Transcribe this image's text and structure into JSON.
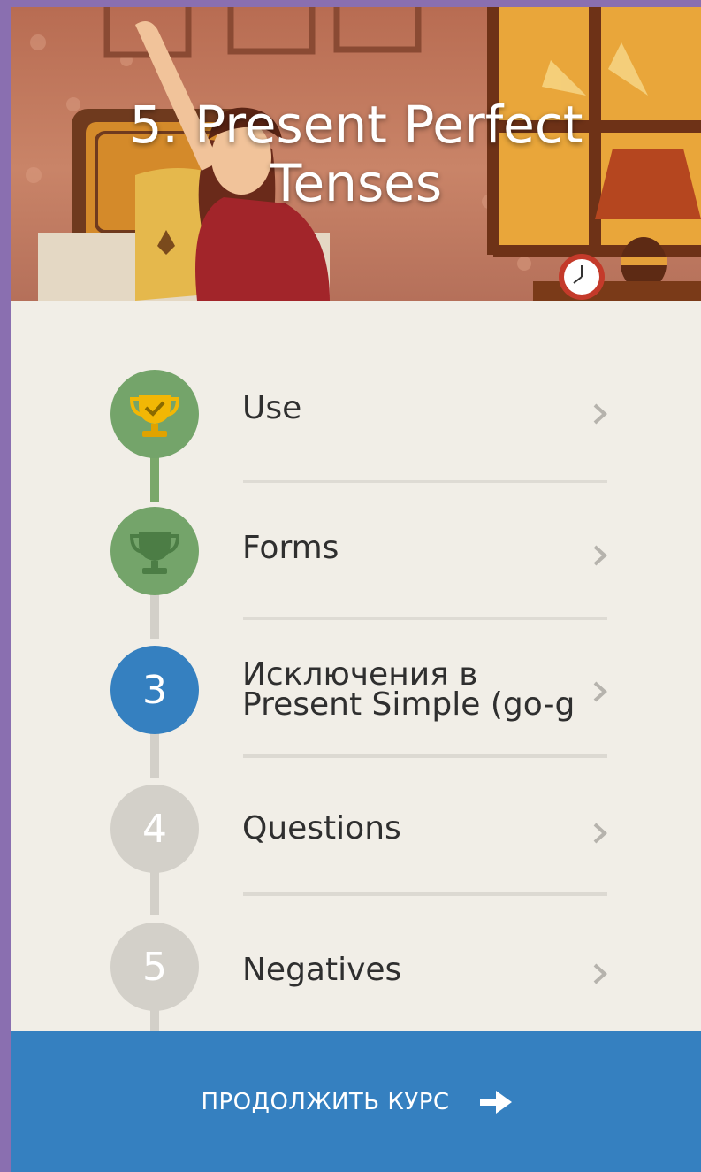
{
  "header": {
    "title_line1": "5. Present Perfect",
    "title_line2": "Tenses"
  },
  "lessons": [
    {
      "step": "1",
      "label": "Use",
      "status": "completed",
      "icon": "trophy-gold-check-icon"
    },
    {
      "step": "2",
      "label": "Forms",
      "status": "completed",
      "icon": "trophy-green-icon"
    },
    {
      "step": "3",
      "label_line1": "Исключения в",
      "label_line2": "Present Simple (go-g",
      "status": "current"
    },
    {
      "step": "4",
      "label": "Questions",
      "status": "locked"
    },
    {
      "step": "5",
      "label": "Negatives",
      "status": "locked"
    }
  ],
  "cta": {
    "label": "ПРОДОЛЖИТЬ КУРС",
    "icon": "arrow-right-icon"
  },
  "colors": {
    "accent": "#3580c0",
    "completed": "#74a46a",
    "locked": "#d3d0c9",
    "page_background": "#f1eee7",
    "outer_background": "#8a6fb0"
  }
}
